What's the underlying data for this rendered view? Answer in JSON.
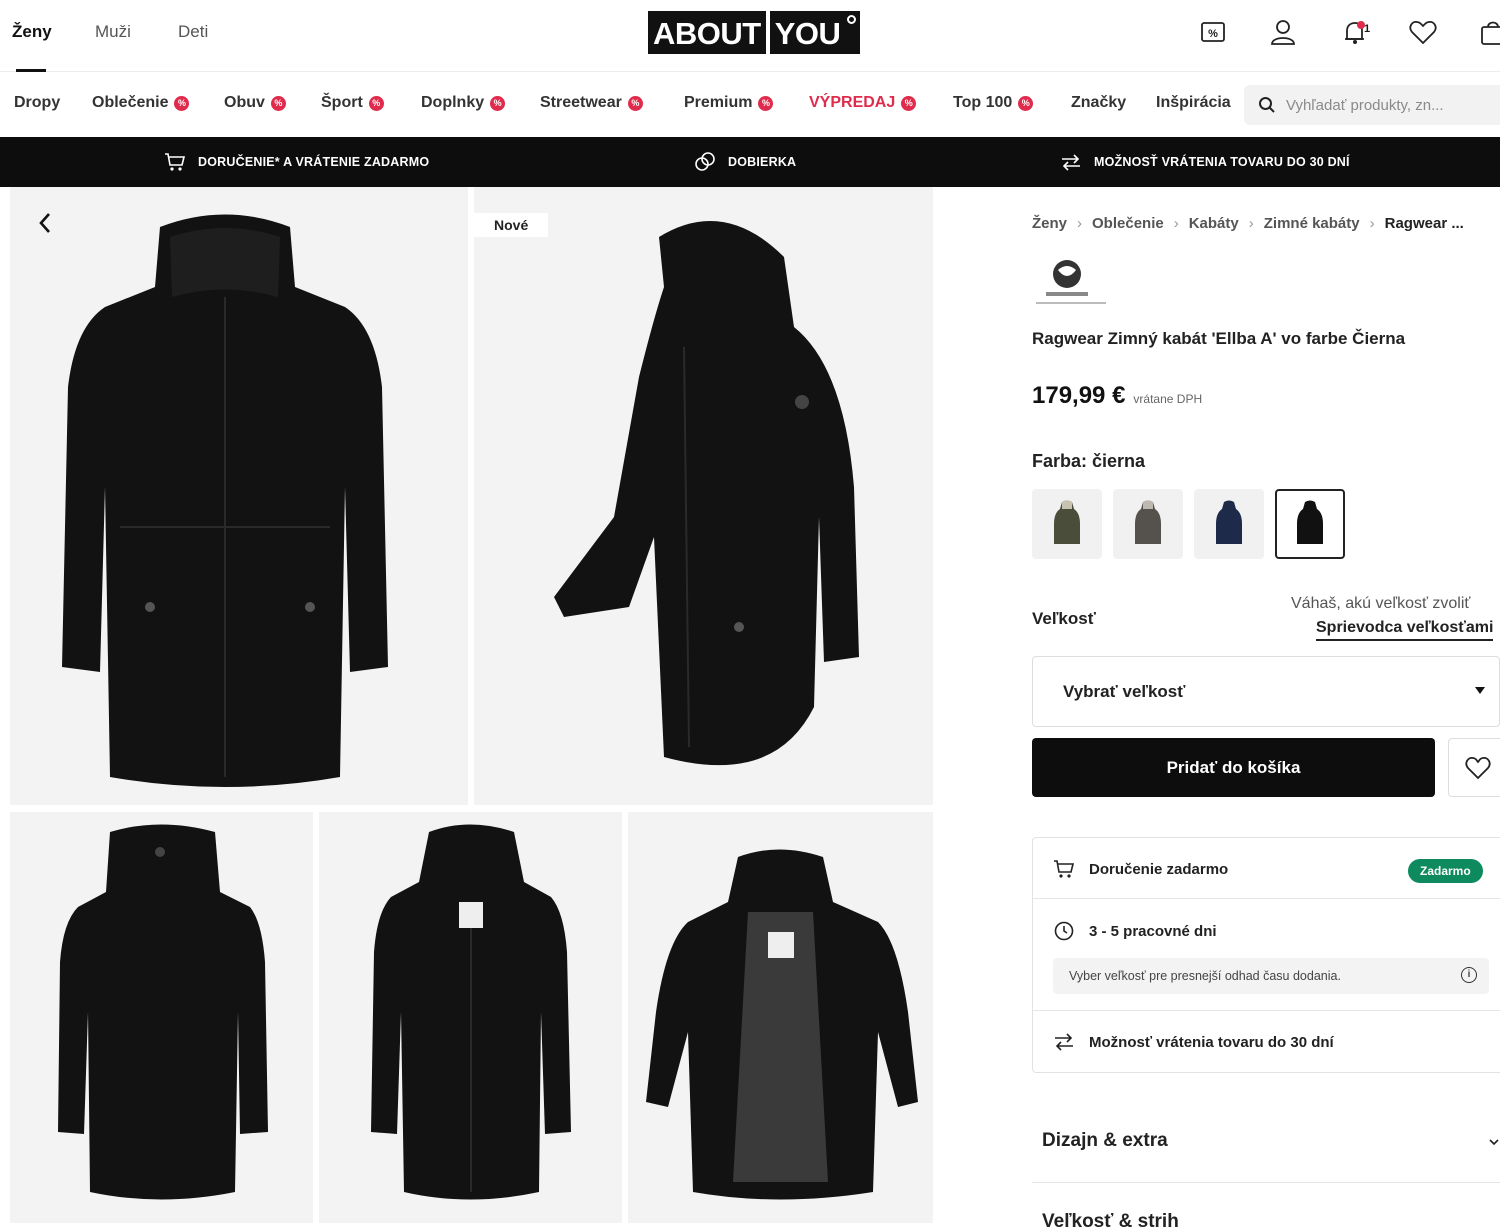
{
  "header": {
    "gender_tabs": [
      "Ženy",
      "Muži",
      "Deti"
    ],
    "logo_left": "ABOUT",
    "logo_right": "YOU",
    "notification_count": "1",
    "icons": [
      "discount-icon",
      "user-icon",
      "bell-icon",
      "heart-icon",
      "bag-icon"
    ]
  },
  "nav": {
    "items": [
      "Dropy",
      "Oblečenie",
      "Obuv",
      "Šport",
      "Doplnky",
      "Streetwear",
      "Premium",
      "VÝPREDAJ",
      "Top 100",
      "Značky",
      "Inšpirácia"
    ],
    "search_placeholder": "Vyhľadať produkty, zn..."
  },
  "promo": {
    "items": [
      "DORUČENIE* A VRÁTENIE ZADARMO",
      "DOBIERKA",
      "MOŽNOSŤ VRÁTENIA TOVARU DO 30 DNÍ"
    ]
  },
  "gallery": {
    "badge": "Nové"
  },
  "product": {
    "breadcrumb": [
      "Ženy",
      "Oblečenie",
      "Kabáty",
      "Zimné kabáty",
      "Ragwear ..."
    ],
    "title": "Ragwear Zimný kabát 'Ellba A' vo farbe Čierna",
    "price": "179,99 €",
    "price_note": "vrátane DPH",
    "color_label": "Farba: čierna",
    "swatches": [
      "olive",
      "grey",
      "navy",
      "black"
    ],
    "size_label": "Veľkosť",
    "size_help": "Váhaš, akú veľkosť zvoliť",
    "size_guide": "Sprievodca veľkosťami",
    "size_select": "Vybrať veľkosť",
    "add_to_cart": "Pridať do košíka"
  },
  "delivery": {
    "free_delivery": "Doručenie zadarmo",
    "free_badge": "Zadarmo",
    "days": "3 - 5 pracovné dni",
    "hint": "Vyber veľkosť pre presnejší odhad času dodania.",
    "returns": "Možnosť vrátenia tovaru do 30 dní"
  },
  "accordions": [
    "Dizajn & extra",
    "Veľkosť & strih"
  ],
  "colors": {
    "accent_sale": "#e02c4c",
    "free_badge": "#0e8a5f",
    "bar": "#0d0d0d"
  }
}
